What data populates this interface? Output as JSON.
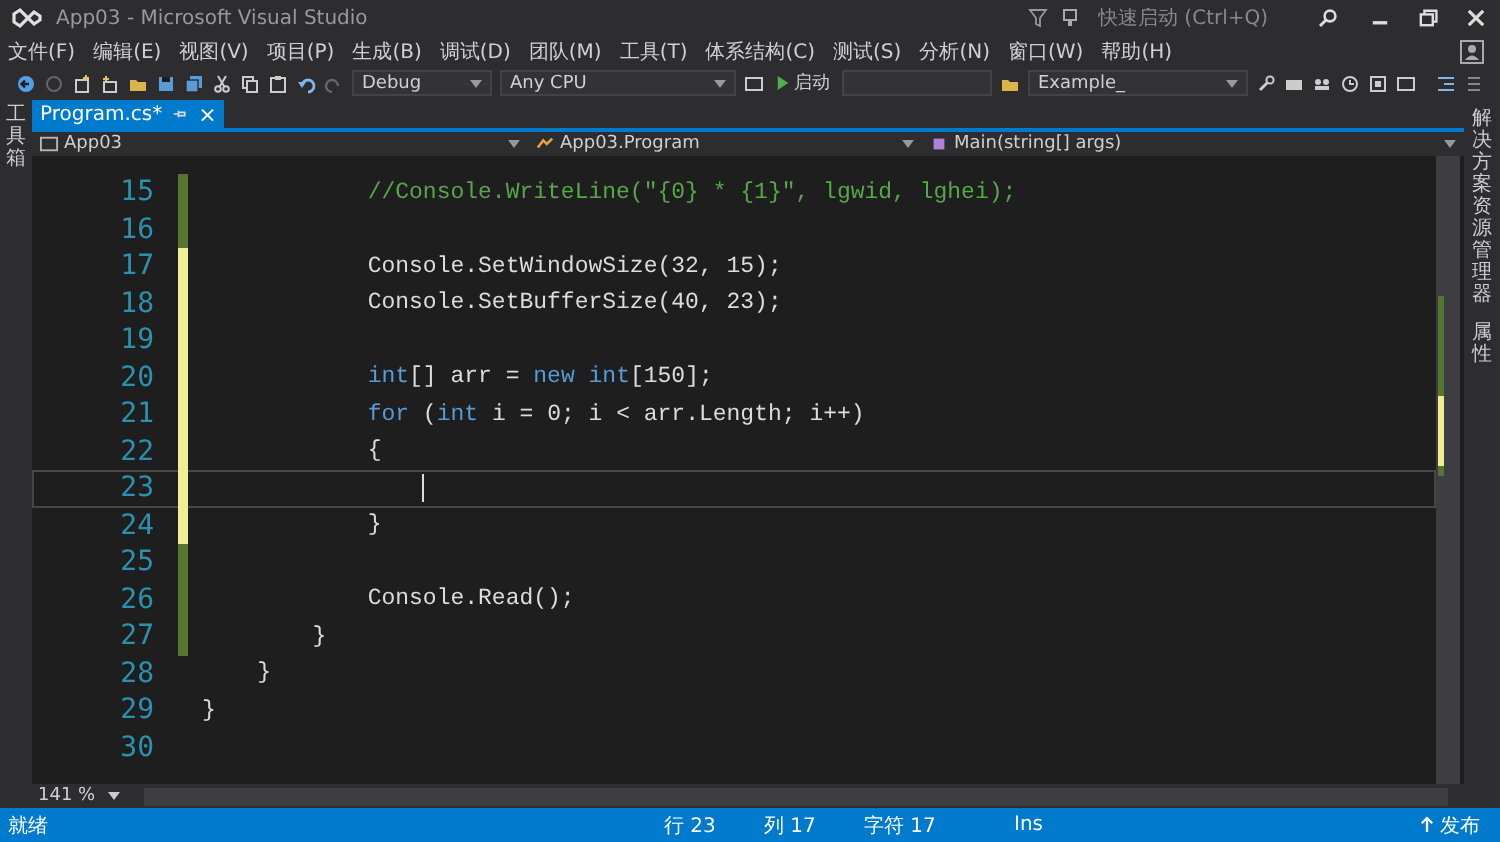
{
  "window": {
    "title": "App03 - Microsoft Visual Studio",
    "quick_launch": {
      "placeholder": "快速启动 (Ctrl+Q)"
    }
  },
  "menu": [
    "文件(F)",
    "编辑(E)",
    "视图(V)",
    "项目(P)",
    "生成(B)",
    "调试(D)",
    "团队(M)",
    "工具(T)",
    "体系结构(C)",
    "测试(S)",
    "分析(N)",
    "窗口(W)",
    "帮助(H)"
  ],
  "toolbar": {
    "configuration": "Debug",
    "platform": "Any CPU",
    "start": "启动",
    "target": "Example_"
  },
  "left_strip": {
    "label": "工具箱"
  },
  "right_strip": {
    "labels": [
      "解决方案资源管理器",
      "属性"
    ]
  },
  "tabs": [
    {
      "label": "Program.cs*",
      "selected": true,
      "close": "×"
    }
  ],
  "nav": {
    "project": "App03",
    "type": "App03.Program",
    "member": "Main(string[] args)"
  },
  "editor": {
    "zoom": "141 %",
    "lines": [
      {
        "number": "15",
        "color": "#577430",
        "current": false,
        "tokens": [
          {
            "kind": "comment",
            "text": "            //Console.WriteLine(\"{0} * {1}\", lgwid, lghei);"
          }
        ]
      },
      {
        "number": "16",
        "color": "#577430",
        "current": false
      },
      {
        "number": "17",
        "color": "#efef91",
        "current": false,
        "tokens": [
          {
            "kind": "plain",
            "text": "            Console.SetWindowSize(32, 15);"
          }
        ]
      },
      {
        "number": "18",
        "color": "#efef91",
        "current": false,
        "tokens": [
          {
            "kind": "plain",
            "text": "            Console.SetBufferSize(40, 23);"
          }
        ]
      },
      {
        "number": "19",
        "color": "#efef91",
        "current": false
      },
      {
        "number": "20",
        "color": "#efef91",
        "current": false,
        "tokens": [
          {
            "kind": "keyword",
            "text": "            int"
          },
          {
            "kind": "plain",
            "text": "[] arr = "
          },
          {
            "kind": "keyword",
            "text": "new int"
          },
          {
            "kind": "plain",
            "text": "[150];"
          }
        ]
      },
      {
        "number": "21",
        "color": "#efef91",
        "current": false,
        "tokens": [
          {
            "kind": "keyword",
            "text": "            for"
          },
          {
            "kind": "plain",
            "text": " ("
          },
          {
            "kind": "keyword",
            "text": "int"
          },
          {
            "kind": "plain",
            "text": " i = 0; i < arr.Length; i++)"
          }
        ]
      },
      {
        "number": "22",
        "color": "#efef91",
        "current": false,
        "tokens": [
          {
            "kind": "plain",
            "text": "            {"
          }
        ]
      },
      {
        "number": "23",
        "color": "#efef91",
        "current": true
      },
      {
        "number": "24",
        "color": "#efef91",
        "current": false,
        "tokens": [
          {
            "kind": "plain",
            "text": "            }"
          }
        ]
      },
      {
        "number": "25",
        "color": "#577430",
        "current": false
      },
      {
        "number": "26",
        "color": "#577430",
        "current": false,
        "tokens": [
          {
            "kind": "plain",
            "text": "            Console.Read();"
          }
        ]
      },
      {
        "number": "27",
        "color": "#577430",
        "current": false,
        "tokens": [
          {
            "kind": "plain",
            "text": "        }"
          }
        ]
      },
      {
        "number": "28",
        "current": false,
        "tokens": [
          {
            "kind": "plain",
            "text": "    }"
          }
        ]
      },
      {
        "number": "29",
        "current": false,
        "tokens": [
          {
            "kind": "plain",
            "text": "}"
          }
        ]
      },
      {
        "number": "30",
        "current": false
      }
    ]
  },
  "status_bar": {
    "message": "就绪",
    "line": "行 23",
    "column": "列 17",
    "char": "字符 17",
    "mode": "Ins",
    "publish": "发布"
  }
}
